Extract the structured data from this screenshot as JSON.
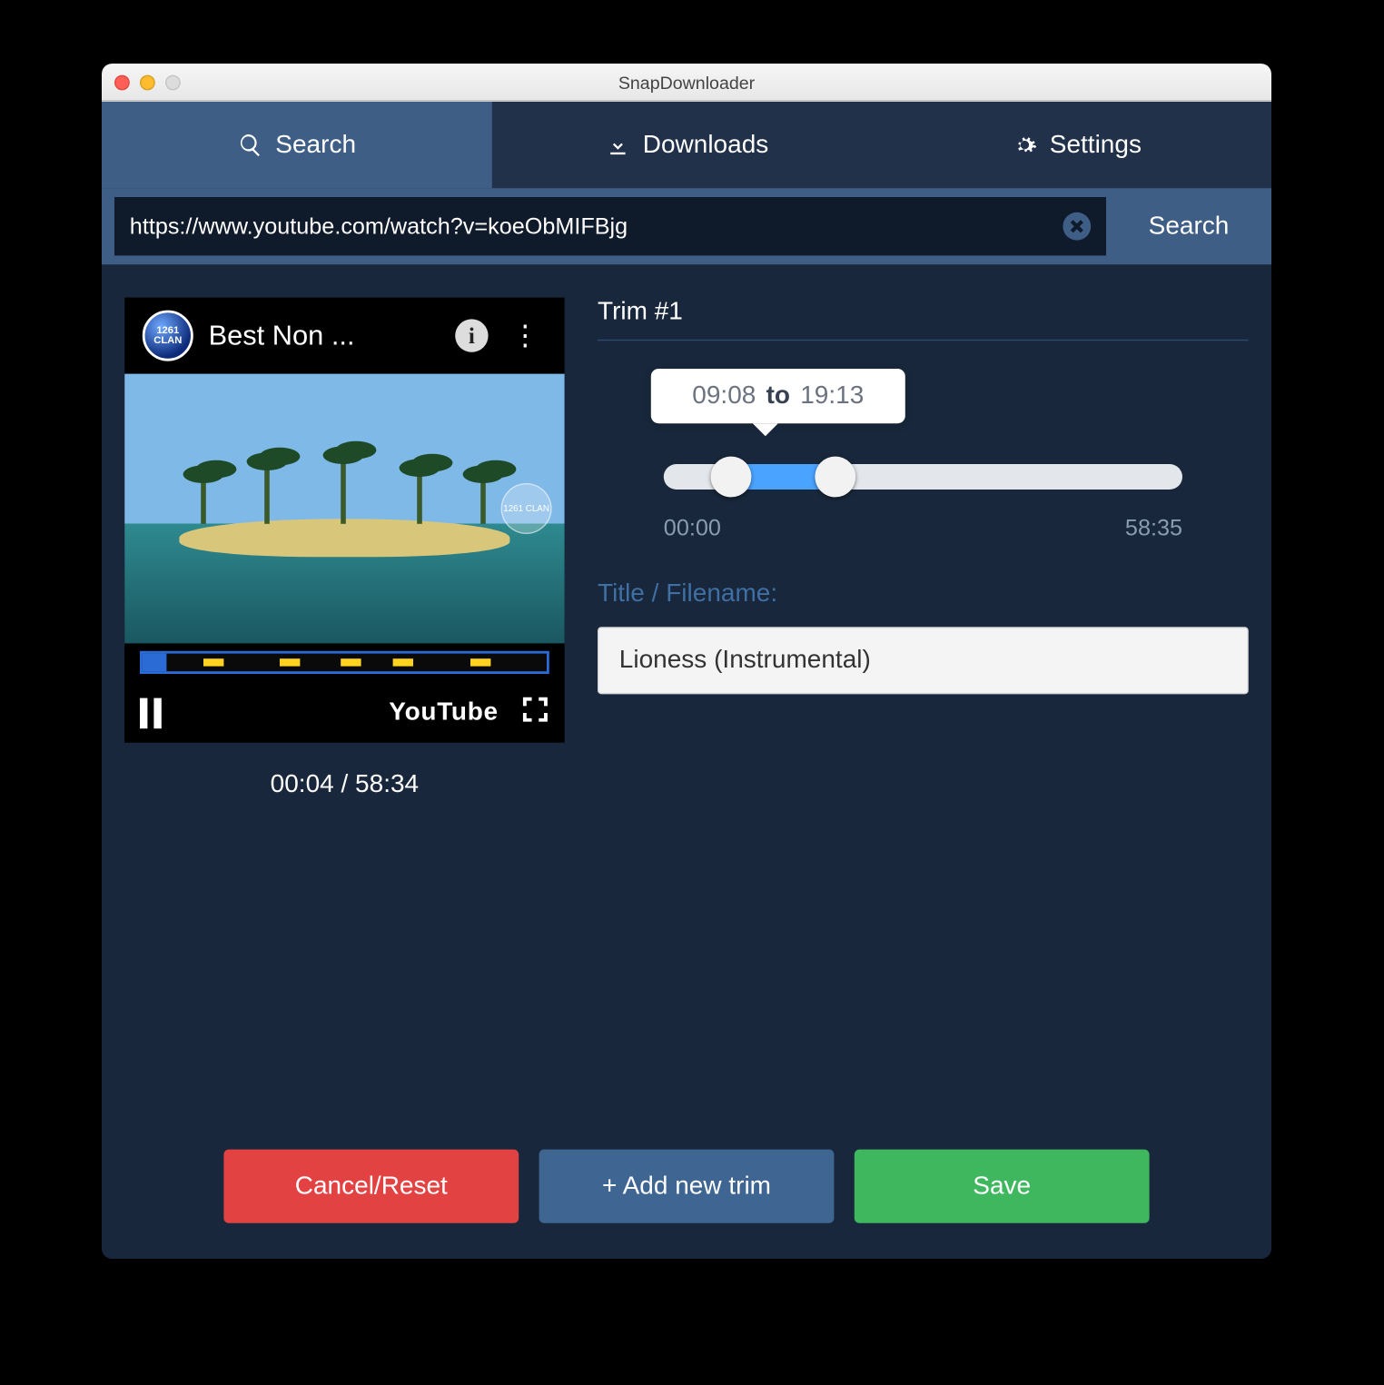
{
  "window": {
    "title": "SnapDownloader"
  },
  "tabs": {
    "search": "Search",
    "downloads": "Downloads",
    "settings": "Settings",
    "active": "search"
  },
  "search": {
    "url": "https://www.youtube.com/watch?v=koeObMIFBjg",
    "button": "Search"
  },
  "preview": {
    "channel_badge": "1261 CLAN",
    "video_title": "Best Non ...",
    "provider": "YouTube",
    "timecode": "00:04 / 58:34",
    "watermark": "1261 CLAN"
  },
  "trim": {
    "heading": "Trim #1",
    "tooltip": {
      "from": "09:08",
      "sep": "to",
      "to": "19:13"
    },
    "range": {
      "min_label": "00:00",
      "max_label": "58:35",
      "start_pct": 13,
      "end_pct": 33
    },
    "filename_label": "Title / Filename:",
    "filename": "Lioness (Instrumental)"
  },
  "buttons": {
    "cancel": "Cancel/Reset",
    "add": "+ Add new trim",
    "save": "Save"
  }
}
